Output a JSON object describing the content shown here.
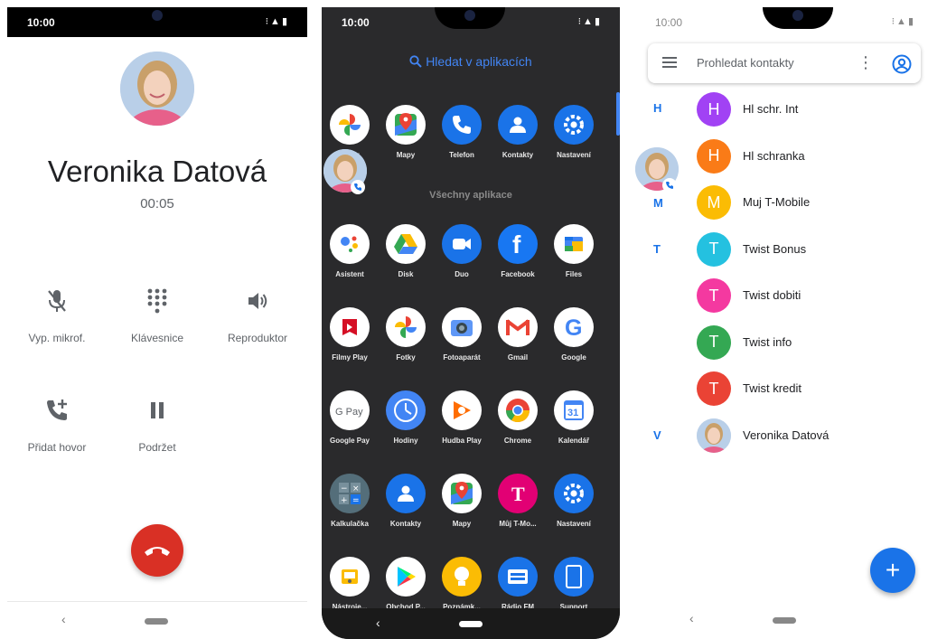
{
  "status": {
    "time": "10:00",
    "icons": "⁝▲▮"
  },
  "call_screen": {
    "caller_name": "Veronika Datová",
    "timer": "00:05",
    "controls": [
      {
        "label": "Vyp. mikrof.",
        "icon": "mic-off-icon"
      },
      {
        "label": "Klávesnice",
        "icon": "dialpad-icon"
      },
      {
        "label": "Reproduktor",
        "icon": "speaker-icon"
      },
      {
        "label": "Přidat hovor",
        "icon": "add-call-icon"
      },
      {
        "label": "Podržet",
        "icon": "pause-icon"
      }
    ],
    "end_call_color": "#d93025",
    "nav_back": "‹"
  },
  "app_drawer": {
    "search_label": "Hledat v aplikacích",
    "section_label": "Všechny aplikace",
    "favorites": [
      {
        "name": "Fotky",
        "color": "#ffffff"
      },
      {
        "name": "Mapy",
        "color": "#ffffff"
      },
      {
        "name": "Telefon",
        "color": "#1a73e8"
      },
      {
        "name": "Kontakty",
        "color": "#1a73e8"
      },
      {
        "name": "Nastavení",
        "color": "#1a73e8"
      }
    ],
    "apps": [
      {
        "name": "Asistent",
        "color": "#ffffff"
      },
      {
        "name": "Disk",
        "color": "#ffffff"
      },
      {
        "name": "Duo",
        "color": "#1a73e8"
      },
      {
        "name": "Facebook",
        "color": "#1877f2"
      },
      {
        "name": "Files",
        "color": "#ffffff"
      },
      {
        "name": "Filmy Play",
        "color": "#ffffff"
      },
      {
        "name": "Fotky",
        "color": "#ffffff"
      },
      {
        "name": "Fotoaparát",
        "color": "#ffffff"
      },
      {
        "name": "Gmail",
        "color": "#ffffff"
      },
      {
        "name": "Google",
        "color": "#ffffff"
      },
      {
        "name": "Google Pay",
        "color": "#ffffff"
      },
      {
        "name": "Hodiny",
        "color": "#4285f4"
      },
      {
        "name": "Hudba Play",
        "color": "#ffffff"
      },
      {
        "name": "Chrome",
        "color": "#ffffff"
      },
      {
        "name": "Kalendář",
        "color": "#ffffff"
      },
      {
        "name": "Kalkulačka",
        "color": "#546e7a"
      },
      {
        "name": "Kontakty",
        "color": "#1a73e8"
      },
      {
        "name": "Mapy",
        "color": "#ffffff"
      },
      {
        "name": "Můj T-Mo...",
        "color": "#e20074"
      },
      {
        "name": "Nastavení",
        "color": "#1a73e8"
      },
      {
        "name": "Nástroje...",
        "color": "#ffffff"
      },
      {
        "name": "Obchod P...",
        "color": "#ffffff"
      },
      {
        "name": "Poznámk...",
        "color": "#fbbc04"
      },
      {
        "name": "Rádio FM",
        "color": "#1a73e8"
      },
      {
        "name": "Support",
        "color": "#1a73e8"
      }
    ],
    "nav_back": "‹"
  },
  "contacts": {
    "search_placeholder": "Prohledat kontakty",
    "more": "⋮",
    "letters": [
      "H",
      "M",
      "T",
      "V"
    ],
    "list": [
      {
        "name": "Hl schr. Int",
        "initial": "H",
        "color": "#a142f4"
      },
      {
        "name": "Hl schranka",
        "initial": "H",
        "color": "#fa7b17"
      },
      {
        "name": "Muj T-Mobile",
        "initial": "M",
        "color": "#fbbc04"
      },
      {
        "name": "Twist Bonus",
        "initial": "T",
        "color": "#24c1e0"
      },
      {
        "name": "Twist dobiti",
        "initial": "T",
        "color": "#f439a0"
      },
      {
        "name": "Twist info",
        "initial": "T",
        "color": "#34a853"
      },
      {
        "name": "Twist kredit",
        "initial": "T",
        "color": "#ea4335"
      },
      {
        "name": "Veronika Datová",
        "initial": "",
        "color": "#cfd9ea"
      }
    ],
    "fab": "+",
    "nav_back": "‹"
  }
}
